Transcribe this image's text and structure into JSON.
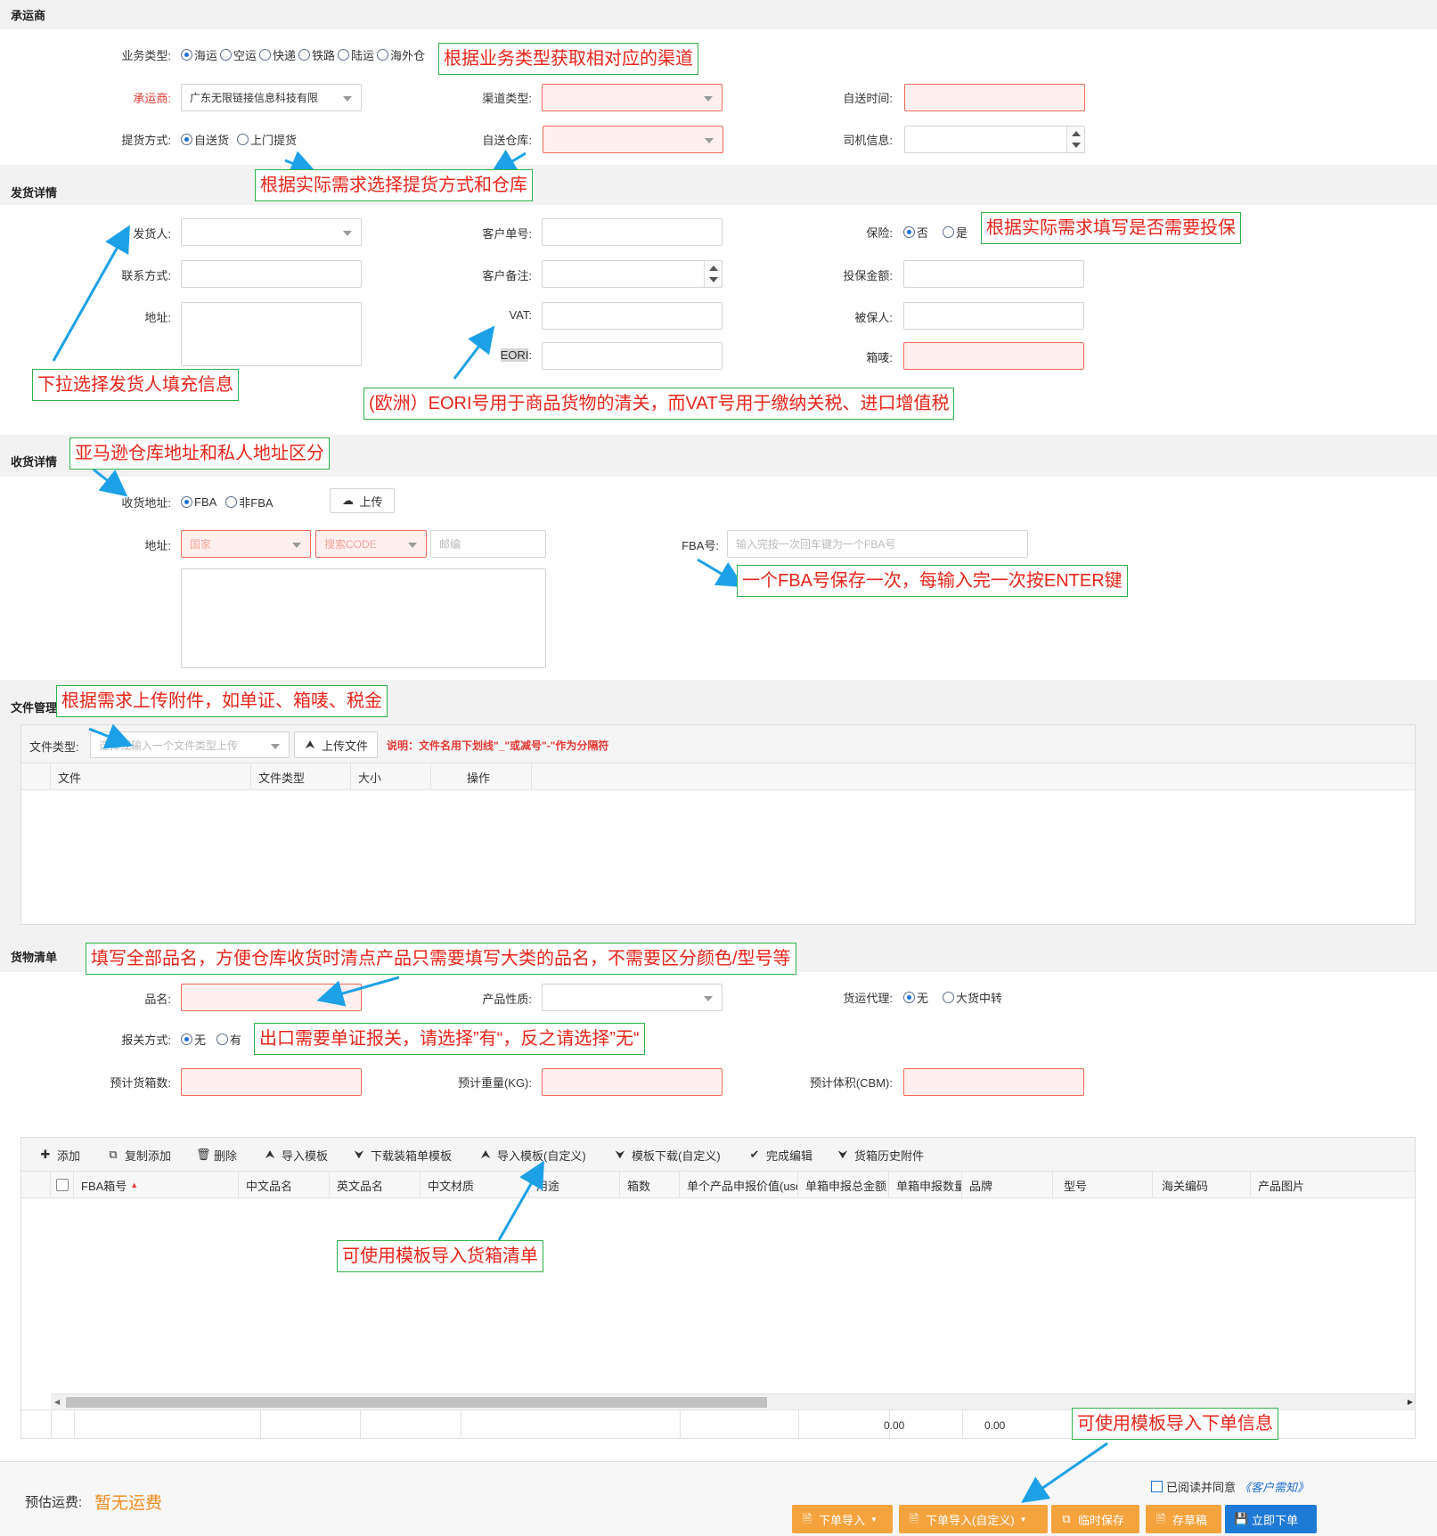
{
  "carrier": {
    "section_title": "承运商",
    "biz_type_label": "业务类型:",
    "biz_types": [
      "海运",
      "空运",
      "快递",
      "铁路",
      "陆运",
      "海外仓"
    ],
    "carrier_label": "承运商:",
    "carrier_value": "广东无限链接信息科技有限",
    "channel_type_label": "渠道类型:",
    "self_send_time_label": "自送时间:",
    "pickup_label": "提货方式:",
    "pickup_options": [
      "自送货",
      "上门提货"
    ],
    "self_warehouse_label": "自送仓库:",
    "driver_label": "司机信息:"
  },
  "shipper": {
    "section_title": "发货详情",
    "sender_label": "发货人:",
    "customer_no_label": "客户单号:",
    "insurance_label": "保险:",
    "insurance_options": [
      "否",
      "是"
    ],
    "contact_label": "联系方式:",
    "customer_note_label": "客户备注:",
    "insured_amount_label": "投保金额:",
    "address_label": "地址:",
    "vat_label": "VAT:",
    "insured_person_label": "被保人:",
    "eori_label": "EORI",
    "eori_colon": ":",
    "box_mark_label": "箱唛:"
  },
  "receiver": {
    "section_title": "收货详情",
    "recv_addr_label": "收货地址:",
    "recv_options": [
      "FBA",
      "非FBA"
    ],
    "upload_label": "上传",
    "address_label": "地址:",
    "country_placeholder": "国家",
    "code_placeholder": "搜索CODE",
    "zip_placeholder": "邮编",
    "fba_label": "FBA号:",
    "fba_placeholder": "输入完按一次回车键为一个FBA号"
  },
  "files": {
    "section_title": "文件管理",
    "file_type_label": "文件类型:",
    "file_type_placeholder": "选择或输入一个文件类型上传",
    "upload_file_label": "上传文件",
    "note": "说明：文件名用下划线\"_\"或减号\"-\"作为分隔符",
    "columns": [
      "文件",
      "文件类型",
      "大小",
      "操作"
    ]
  },
  "goods": {
    "section_title": "货物清单",
    "name_label": "品名:",
    "product_nature_label": "产品性质:",
    "forwarder_label": "货运代理:",
    "forwarder_options": [
      "无",
      "大货中转"
    ],
    "customs_label": "报关方式:",
    "customs_options": [
      "无",
      "有"
    ],
    "est_boxes_label": "预计货箱数:",
    "est_weight_label": "预计重量(KG):",
    "est_volume_label": "预计体积(CBM):",
    "toolbar": [
      "添加",
      "复制添加",
      "删除",
      "导入模板",
      "下载装箱单模板",
      "导入模板(自定义)",
      "模板下载(自定义)",
      "完成编辑",
      "货箱历史附件"
    ],
    "columns": [
      "FBA箱号",
      "中文品名",
      "英文品名",
      "中文材质",
      "用途",
      "箱数",
      "单个产品申报价值(usd",
      "单箱申报总金额",
      "单箱申报数量",
      "品牌",
      "型号",
      "海关编码",
      "产品图片"
    ],
    "footer_totals": [
      "0.00",
      "0.00"
    ]
  },
  "footer": {
    "est_freight_label": "预估运费:",
    "est_freight_value": "暂无运费",
    "agree_text": "已阅读并同意",
    "agree_link": "《客户需知》",
    "buttons": [
      "下单导入",
      "下单导入(自定义)",
      "临时保存",
      "存草稿",
      "立即下单"
    ]
  },
  "notes": {
    "n1": "根据业务类型获取相对应的渠道",
    "n2": "根据实际需求选择提货方式和仓库",
    "n3": "根据实际需求填写是否需要投保",
    "n4": "下拉选择发货人填充信息",
    "n5": "(欧洲）EORI号用于商品货物的清关，而VAT号用于缴纳关税、进口增值税",
    "n6": "亚马逊仓库地址和私人地址区分",
    "n7": "一个FBA号保存一次，每输入完一次按ENTER键",
    "n8": "根据需求上传附件，如单证、箱唛、税金",
    "n9": "填写全部品名，方便仓库收货时清点产品只需要填写大类的品名，不需要区分颜色/型号等",
    "n10": "出口需要单证报关，请选择”有“，反之请选择”无“",
    "n11": "可使用模板导入货箱清单",
    "n12": "可使用模板导入下单信息"
  },
  "colors": {
    "required_bg": "#fff0ef",
    "required_border": "#f26a5a",
    "note_border": "#2db34a",
    "note_text": "#e8251b",
    "arrow": "#1da1e6",
    "orange_btn": "#f5a33d",
    "primary_btn": "#1f7ad6"
  }
}
